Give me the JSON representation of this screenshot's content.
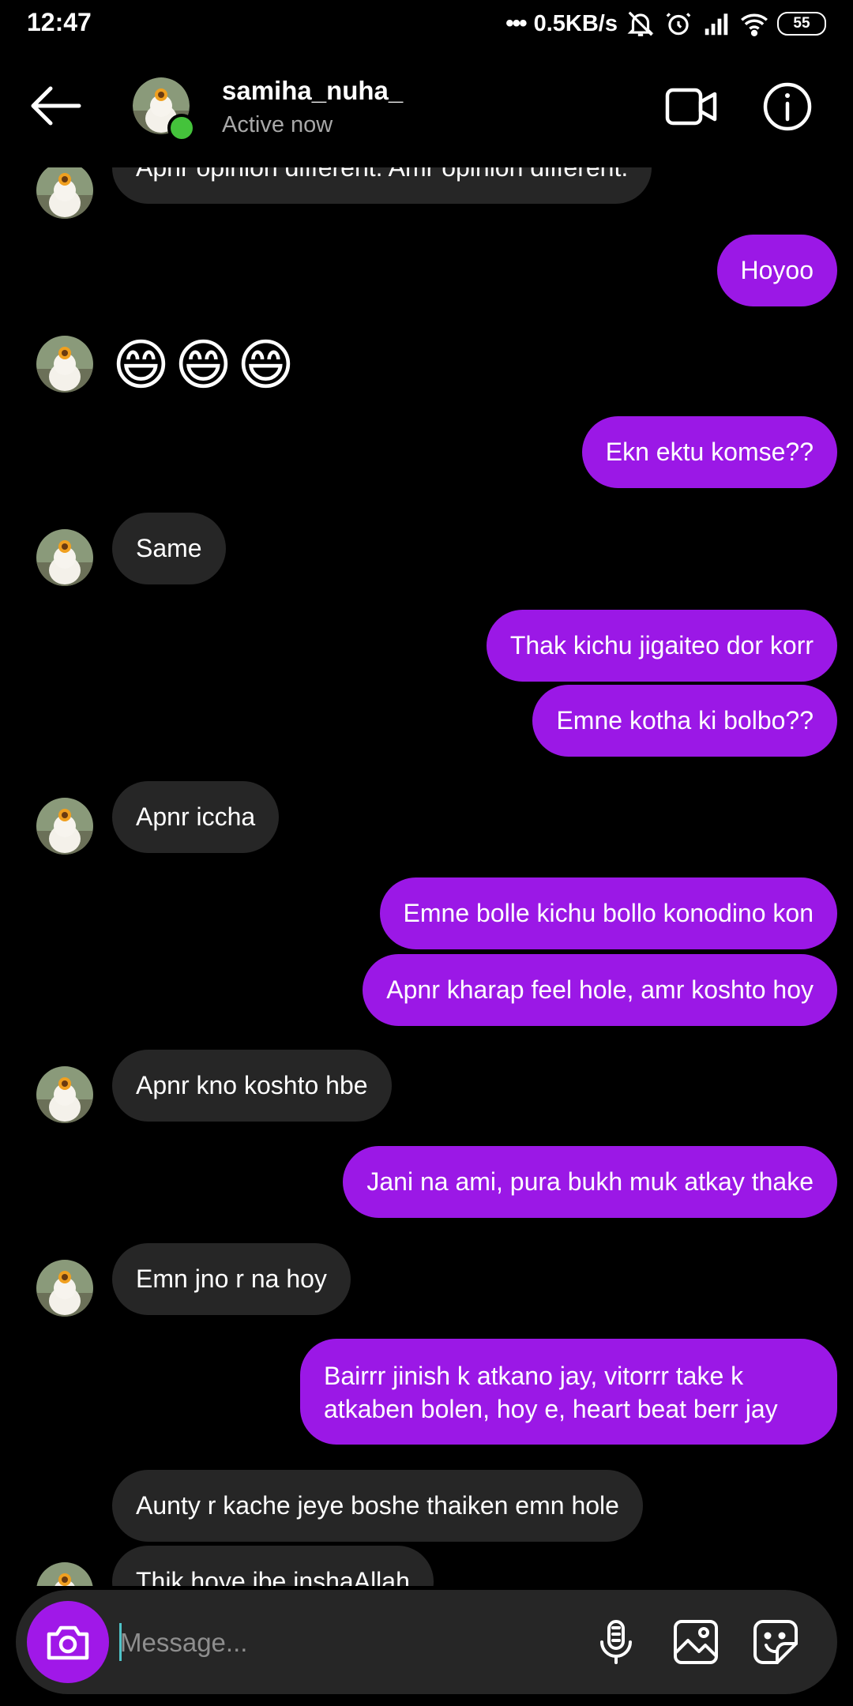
{
  "status_bar": {
    "time": "12:47",
    "net_speed": "0.5KB/s",
    "battery": "55"
  },
  "header": {
    "username": "samiha_nuha_",
    "status": "Active now"
  },
  "messages": [
    {
      "dir": "in",
      "text": "Apnr opinion different. Amr opinion different."
    },
    {
      "dir": "out",
      "text": "Hoyoo"
    },
    {
      "dir": "in",
      "text": "😄😄😄",
      "emoji": true
    },
    {
      "dir": "out",
      "text": "Ekn ektu komse??"
    },
    {
      "dir": "in",
      "text": "Same"
    },
    {
      "dir": "out",
      "text": "Thak kichu jigaiteo dor korr"
    },
    {
      "dir": "out",
      "text": "Emne kotha ki bolbo??"
    },
    {
      "dir": "in",
      "text": "Apnr iccha"
    },
    {
      "dir": "out",
      "text": "Emne bolle kichu bollo konodino kon"
    },
    {
      "dir": "out",
      "text": "Apnr kharap feel hole, amr koshto hoy"
    },
    {
      "dir": "in",
      "text": "Apnr kno koshto hbe"
    },
    {
      "dir": "out",
      "text": "Jani na ami, pura bukh muk atkay thake"
    },
    {
      "dir": "in",
      "text": "Emn jno r na hoy"
    },
    {
      "dir": "out",
      "text": "Bairrr jinish k atkano jay, vitorrr take k atkaben bolen, hoy e, heart beat berr jay"
    },
    {
      "dir": "in",
      "text": "Aunty r kache jeye boshe thaiken emn hole"
    },
    {
      "dir": "in",
      "text": "Thik hoye jbe inshaAllah"
    }
  ],
  "composer": {
    "placeholder": "Message..."
  },
  "colors": {
    "outgoing_bubble": "#9b18e6",
    "incoming_bubble": "#262626",
    "online_dot": "#44c33b",
    "camera_button": "#a018e8"
  },
  "icons": {
    "back": "arrow-left-icon",
    "video": "video-camera-icon",
    "info": "info-icon",
    "camera": "camera-icon",
    "mic": "microphone-icon",
    "gallery": "gallery-icon",
    "sticker": "sticker-icon"
  }
}
